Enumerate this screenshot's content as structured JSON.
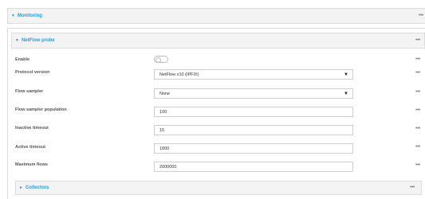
{
  "monitoring": {
    "title": "Monitoring",
    "menu": "•••"
  },
  "netflow": {
    "title": "NetFlow probe",
    "menu": "•••"
  },
  "fields": {
    "enable": {
      "label": "Enable",
      "value": false,
      "menu": "•••"
    },
    "protocol_version": {
      "label": "Protocol version",
      "value": "NetFlow v10 (IPFIX)",
      "menu": "•••"
    },
    "flow_sampler": {
      "label": "Flow sampler",
      "value": "None",
      "menu": "•••"
    },
    "flow_sampler_population": {
      "label": "Flow sampler population",
      "value": "100",
      "menu": "•••"
    },
    "inactive_timeout": {
      "label": "Inactive timeout",
      "value": "15",
      "menu": "•••"
    },
    "active_timeout": {
      "label": "Active timeout",
      "value": "1800",
      "menu": "•••"
    },
    "maximum_flows": {
      "label": "Maximum flows",
      "value": "2000000",
      "menu": "•••"
    }
  },
  "collectors": {
    "title": "Collectors",
    "menu": "•••"
  },
  "icons": {
    "expanded": "triangle-down-icon",
    "collapsed": "triangle-right-icon",
    "select": "caret-down-icon",
    "menu": "more-horizontal-icon"
  },
  "colors": {
    "accent": "#2f9bd6",
    "header_bg": "#f3f3f3",
    "border": "#dcdcdc"
  }
}
